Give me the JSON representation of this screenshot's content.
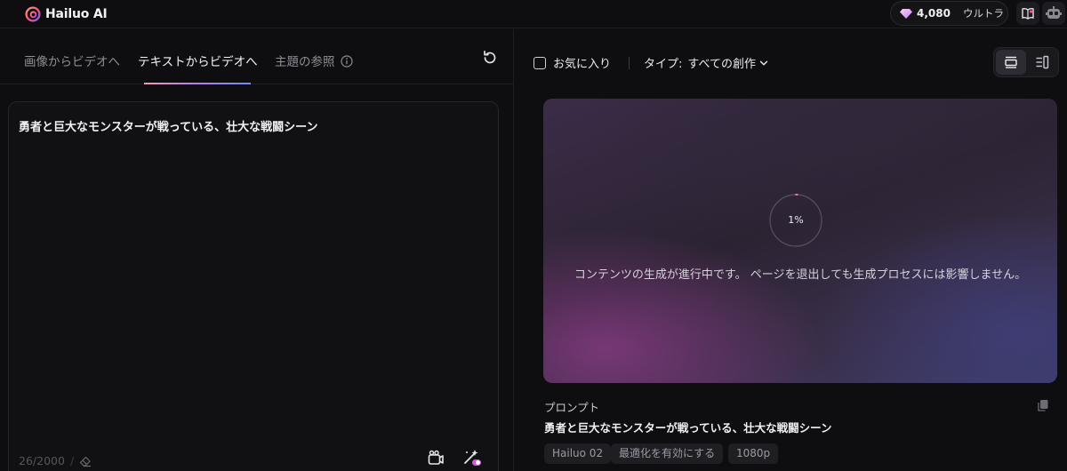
{
  "app": {
    "name": "Hailuo AI"
  },
  "header": {
    "credits": "4,080",
    "plan": "ウルトラ"
  },
  "tabs": [
    {
      "label": "画像からビデオへ"
    },
    {
      "label": "テキストからビデオへ"
    },
    {
      "label": "主題の参照"
    }
  ],
  "active_tab": "テキストからビデオへ",
  "prompt_input": {
    "value": "勇者と巨大なモンスターが戦っている、壮大な戦闘シーン",
    "char_count": "26/2000"
  },
  "filters": {
    "favorites_label": "お気に入り",
    "type_label": "タイプ:",
    "type_value": "すべての創作"
  },
  "generation": {
    "progress": "1%",
    "progress_fraction": 0.01,
    "message": "コンテンツの生成が進行中です。 ページを退出しても生成プロセスには影響しません。",
    "prompt_heading": "プロンプト",
    "prompt_text": "勇者と巨大なモンスターが戦っている、壮大な戦闘シーン",
    "tags": [
      "Hailuo 02",
      "最適化を有効にする",
      "1080p"
    ]
  },
  "colors": {
    "accent_gradient_start": "#f39bb5",
    "accent_gradient_end": "#6e8cf7",
    "background": "#0e0e10"
  },
  "icons": {
    "logo": "hailuo-logo-icon",
    "credits": "gem-icon",
    "book": "book-icon",
    "avatar": "robot-avatar-icon",
    "refresh": "refresh-icon",
    "info": "info-icon",
    "clear": "eraser-icon",
    "camera": "camera-movement-icon",
    "magic": "magic-wand-icon",
    "copy": "copy-icon",
    "view_grid": "single-view-icon",
    "view_list": "side-panel-view-icon"
  }
}
